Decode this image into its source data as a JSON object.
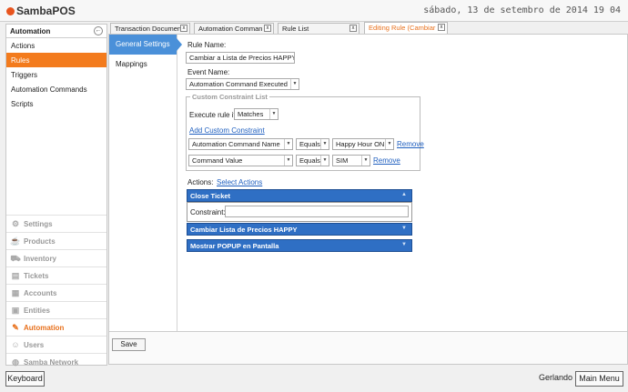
{
  "app": {
    "logo": "SambaPOS",
    "datetime": "sábado, 13 de setembro de 2014 19 04"
  },
  "sidebar": {
    "header": "Automation",
    "back_icon": "back-arrow-icon",
    "items": [
      {
        "label": "Actions"
      },
      {
        "label": "Rules",
        "active": true
      },
      {
        "label": "Triggers"
      },
      {
        "label": "Automation Commands"
      },
      {
        "label": "Scripts"
      }
    ],
    "modules": [
      {
        "label": "Settings",
        "icon": "gear-icon",
        "glyph": "⚙"
      },
      {
        "label": "Products",
        "icon": "cup-icon",
        "glyph": "☕"
      },
      {
        "label": "Inventory",
        "icon": "truck-icon",
        "glyph": "⛟"
      },
      {
        "label": "Tickets",
        "icon": "ticket-icon",
        "glyph": "▤"
      },
      {
        "label": "Accounts",
        "icon": "calculator-icon",
        "glyph": "▦"
      },
      {
        "label": "Entities",
        "icon": "entities-icon",
        "glyph": "▣"
      },
      {
        "label": "Automation",
        "icon": "pencil-icon",
        "glyph": "✎",
        "active": true
      },
      {
        "label": "Users",
        "icon": "user-icon",
        "glyph": "☺"
      },
      {
        "label": "Samba Network",
        "icon": "globe-icon",
        "glyph": "◍"
      }
    ]
  },
  "tabs": [
    {
      "label": "Transaction Documen",
      "close": "x"
    },
    {
      "label": "Automation Comman",
      "close": "x"
    },
    {
      "label": "Rule List",
      "close": "x"
    },
    {
      "label": "Editing Rule (Cambiar",
      "close": "x",
      "active": true
    }
  ],
  "subnav": [
    {
      "label": "General Settings",
      "active": true
    },
    {
      "label": "Mappings"
    }
  ],
  "form": {
    "rule_name_label": "Rule Name:",
    "rule_name_value": "Cambiar a Lista de Precios HAPPY",
    "event_name_label": "Event Name:",
    "event_name_value": "Automation Command Executed",
    "custom_constraint_title": "Custom Constraint List",
    "execute_rule_label": "Execute rule if",
    "execute_rule_value": "Matches",
    "add_constraint_link": "Add Custom Constraint",
    "constraints": [
      {
        "field": "Automation Command Name",
        "operator": "Equals",
        "value": "Happy Hour ON",
        "remove": "Remove"
      },
      {
        "field": "Command Value",
        "operator": "Equals",
        "value": "SIM",
        "remove": "Remove"
      }
    ],
    "actions_label": "Actions:",
    "select_actions_link": "Select Actions",
    "actions": [
      {
        "label": "Close Ticket",
        "expanded": true
      },
      {
        "label": "Cambiar Lista de Precios HAPPY",
        "expanded": false
      },
      {
        "label": "Mostrar POPUP en Pantalla",
        "expanded": false
      }
    ],
    "constraint_label": "Constraint:",
    "constraint_value": ""
  },
  "buttons": {
    "save": "Save",
    "keyboard": "Keyboard",
    "main_menu": "Main Menu"
  },
  "footer": {
    "user": "Gerlando"
  },
  "colors": {
    "accent_orange": "#f37b1d",
    "action_blue": "#2f6fc4",
    "selected_blue": "#4a90d9"
  }
}
